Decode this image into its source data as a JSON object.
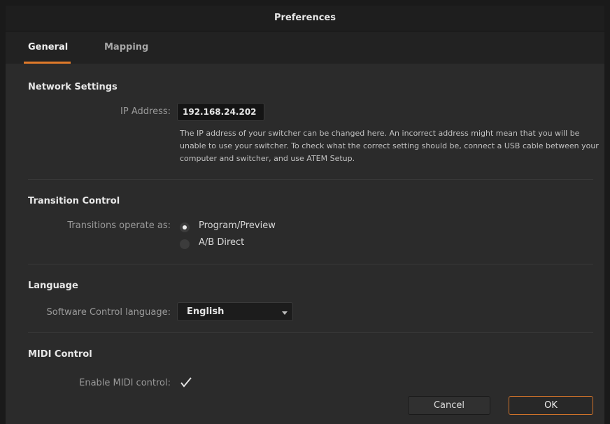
{
  "window": {
    "title": "Preferences"
  },
  "tabs": [
    {
      "label": "General",
      "active": true
    },
    {
      "label": "Mapping",
      "active": false
    }
  ],
  "network": {
    "section_title": "Network Settings",
    "ip_label": "IP Address:",
    "ip_value": "192.168.24.202",
    "help_text": "The IP address of your switcher can be changed here. An incorrect address might mean that you will be unable to use your switcher. To check what the correct setting should be, connect a USB cable between your computer and switcher, and use ATEM Setup."
  },
  "transition": {
    "section_title": "Transition Control",
    "label": "Transitions operate as:",
    "options": [
      {
        "label": "Program/Preview",
        "selected": true
      },
      {
        "label": "A/B Direct",
        "selected": false
      }
    ]
  },
  "language": {
    "section_title": "Language",
    "label": "Software Control language:",
    "selected": "English"
  },
  "midi": {
    "section_title": "MIDI Control",
    "label": "Enable MIDI control:",
    "enabled": true
  },
  "buttons": {
    "cancel": "Cancel",
    "ok": "OK"
  },
  "colors": {
    "accent": "#e07a2a",
    "background": "#2b2b2b",
    "titlebar": "#1e1e1e"
  },
  "icons": {
    "dropdown": "chevron-down-icon",
    "checkbox": "checkmark-icon"
  }
}
